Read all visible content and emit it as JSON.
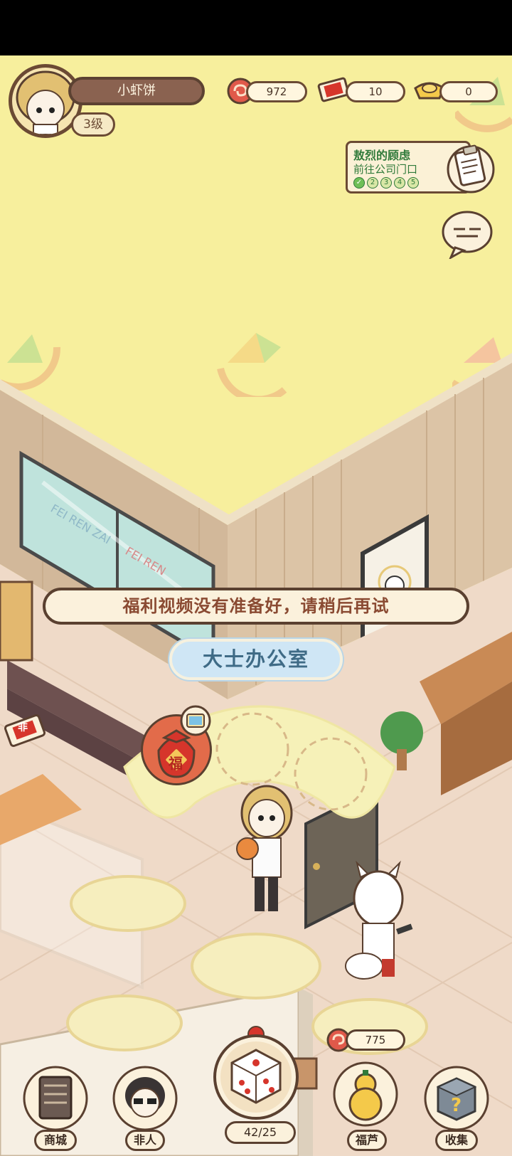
{
  "player": {
    "name": "小虾饼",
    "level": "3级"
  },
  "resources": [
    {
      "icon": "cloud-swirl-icon",
      "value": "972"
    },
    {
      "icon": "fei-ticket-icon",
      "value": "10"
    },
    {
      "icon": "gold-ingot-icon",
      "value": "0"
    }
  ],
  "quest": {
    "title": "敖烈的顾虑",
    "subtitle": "前往公司门口",
    "steps": [
      "✓",
      "2",
      "3",
      "4",
      "5"
    ],
    "completed_steps": 1
  },
  "toast": {
    "message": "福利视频没有准备好，请稍后再试"
  },
  "room": {
    "label": "大士办公室",
    "reward_bag_char": "福",
    "wall_text_1": "FEI REN ZAI",
    "wall_text_2": "FEI REN",
    "ticket_char": "非"
  },
  "bottom_nav": {
    "shop": "商城",
    "feiren": "非人",
    "dice_counter": "42/25",
    "fulu": "福芦",
    "fulu_count": "775",
    "collect": "收集"
  },
  "colors": {
    "background": "#f7ef9d",
    "border": "#5a4030",
    "quest_green": "#2f7a3a",
    "toast_text": "#8a4a32",
    "room_label_bg": "#cfe6f5"
  }
}
